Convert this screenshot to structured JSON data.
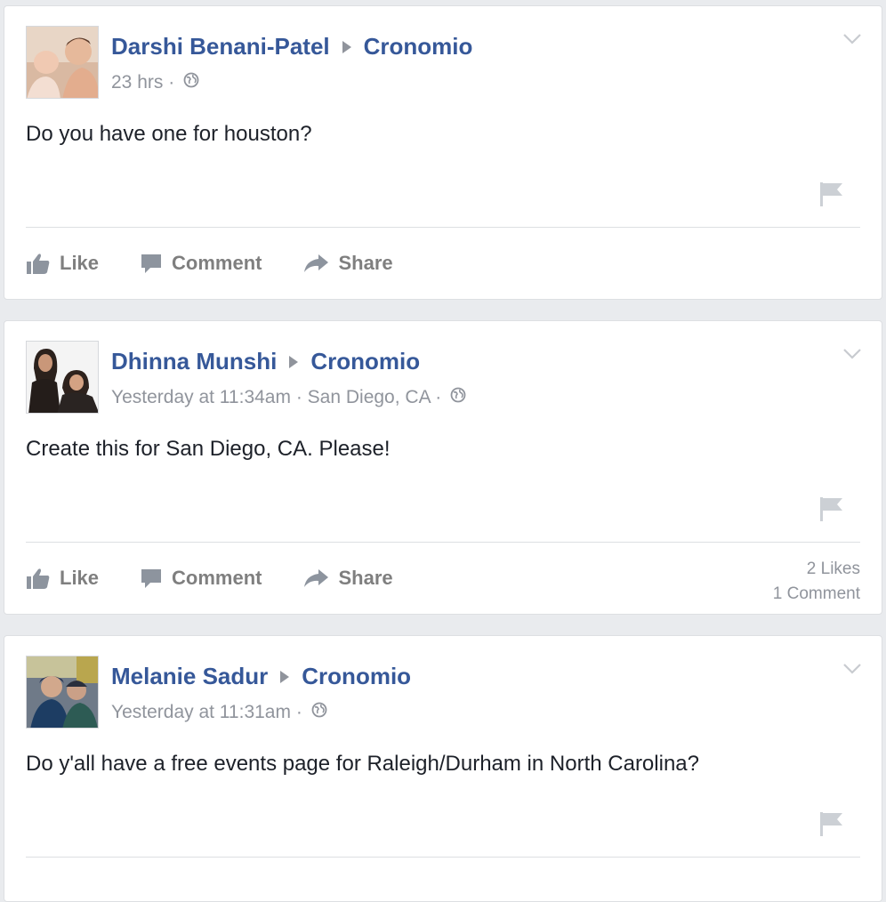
{
  "posts": [
    {
      "author": "Darshi Benani-Patel",
      "target": "Cronomio",
      "time": "23 hrs",
      "location": "",
      "text": "Do you have one for houston?",
      "counts": []
    },
    {
      "author": "Dhinna Munshi",
      "target": "Cronomio",
      "time": "Yesterday at 11:34am",
      "location": "San Diego, CA",
      "text": "Create this for San Diego, CA. Please!",
      "counts": [
        "2 Likes",
        "1 Comment"
      ]
    },
    {
      "author": "Melanie Sadur",
      "target": "Cronomio",
      "time": "Yesterday at 11:31am",
      "location": "",
      "text": "Do y'all have a free events page for Raleigh/Durham in North Carolina?",
      "counts": []
    }
  ],
  "actions": {
    "like": "Like",
    "comment": "Comment",
    "share": "Share"
  },
  "separator": "·",
  "icons": [
    "globe-icon",
    "chevron-down-icon",
    "flag-icon",
    "like-icon",
    "comment-icon",
    "share-icon"
  ],
  "colors": {
    "link": "#365899",
    "meta": "#90949c",
    "text": "#1d2129",
    "background": "#e9ebee"
  }
}
